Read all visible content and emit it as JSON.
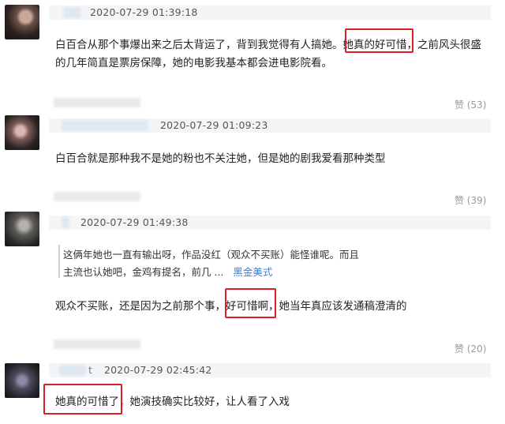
{
  "comments": [
    {
      "timestamp": "2020-07-29 01:39:18",
      "line1_pre": "白百合从那个事爆出来之后太背运了，背到我觉得有人搞她。",
      "line1_highlight": "她真的好可惜",
      "line1_post": "，之前风头很盛",
      "line2": "的几年简直是票房保障，她的电影我基本都会进电影院看。",
      "likes": "赞 (53)"
    },
    {
      "timestamp": "2020-07-29 01:09:23",
      "line1": "白百合就是那种我不是她的粉也不关注她，但是她的剧我爱看那种类型",
      "likes": "赞 (39)"
    },
    {
      "timestamp": "2020-07-29 01:49:38",
      "quote_line1": "这俩年她也一直有输出呀，作品没红（观众不买账）能怪谁呢。而且",
      "quote_line2": "主流也认她吧，金鸡有提名，前几",
      "quote_ellipsis": "...",
      "quote_link": "黑金美式",
      "line_pre": "观众不买账，还是因为之前那个事，",
      "line_highlight": "好可惜啊",
      "line_post": "，她当年真应该发通稿澄清的",
      "likes": "赞 (20)"
    },
    {
      "timestamp": "2020-07-29 02:45:42",
      "name_suffix": "t",
      "line_highlight": "她真的可惜了",
      "line_post": "，她演技确实比较好，让人看了入戏"
    }
  ]
}
